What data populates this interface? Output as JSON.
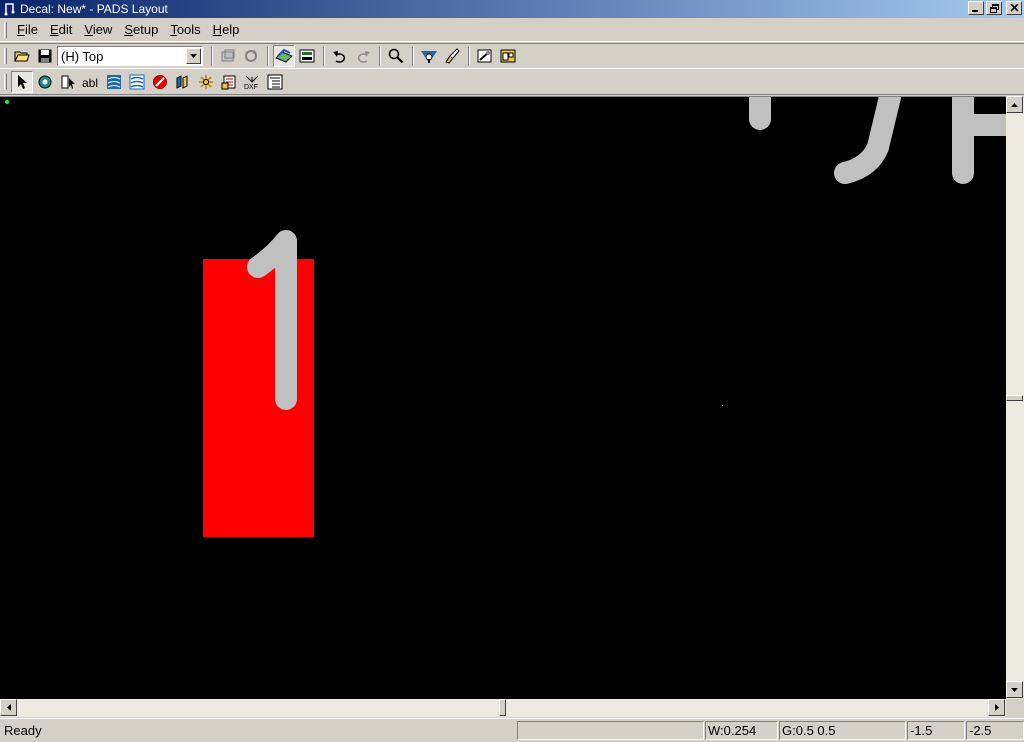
{
  "window": {
    "title": "Decal: New* - PADS Layout"
  },
  "menu": {
    "items": [
      {
        "label_ul": "F",
        "label_rest": "ile"
      },
      {
        "label_ul": "E",
        "label_rest": "dit"
      },
      {
        "label_ul": "V",
        "label_rest": "iew"
      },
      {
        "label_ul": "S",
        "label_rest": "etup"
      },
      {
        "label_ul": "T",
        "label_rest": "ools"
      },
      {
        "label_ul": "H",
        "label_rest": "elp"
      }
    ]
  },
  "toolbar": {
    "layer_selected": "(H) Top"
  },
  "canvas": {
    "background": "#000000",
    "pad_color": "#ff0000",
    "silk_color": "#c0c0c0",
    "origin_color": "#00ff00",
    "pad_label": "1"
  },
  "status": {
    "message": "Ready",
    "width": "W:0.254",
    "grid": "G:0.5 0.5",
    "x": "-1.5",
    "y": "-2.5"
  },
  "icons": {
    "toolbar1": [
      "open-icon",
      "save-icon",
      "layer-combo",
      "properties-icon",
      "refresh-icon",
      "display-toggle-icon",
      "layer-pairs-icon",
      "undo-icon",
      "redo-icon",
      "zoom-icon",
      "view-icon",
      "eraser-icon",
      "decal-wizard-icon",
      "design-toolbar-icon"
    ],
    "toolbar2": [
      "select-icon",
      "pad-icon",
      "terminal-icon",
      "text-icon",
      "copper-icon",
      "copper-cutout-icon",
      "keepout-icon",
      "2d-line-icon",
      "wizard-icon",
      "drafting-icon",
      "dxf-icon",
      "list-icon"
    ]
  }
}
